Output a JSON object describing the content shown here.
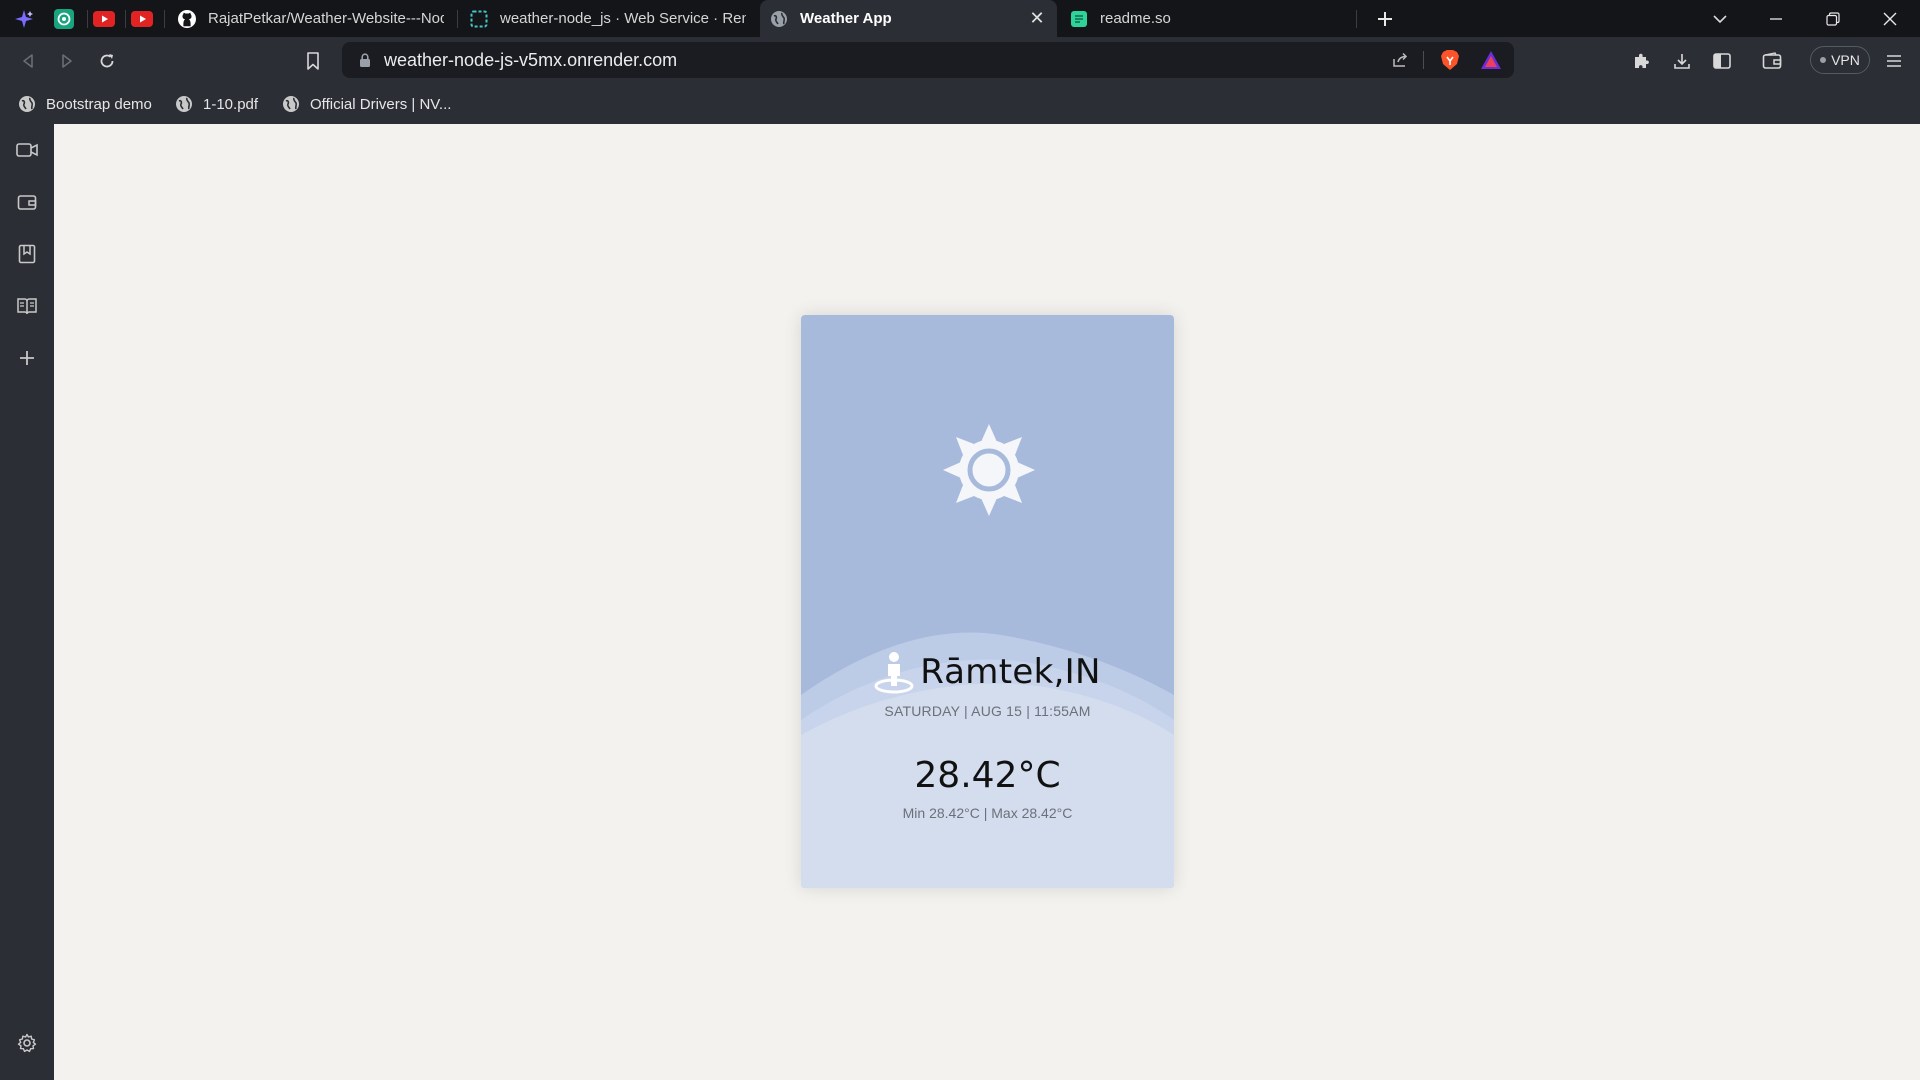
{
  "tabs": [
    {
      "title": "RajatPetkar/Weather-Website---Node-",
      "favicon": "github-icon"
    },
    {
      "title": "weather-node_js · Web Service · Rend",
      "favicon": "render-icon"
    },
    {
      "title": "Weather App",
      "favicon": "globe-icon",
      "active": true
    },
    {
      "title": "readme.so",
      "favicon": "readme-icon"
    }
  ],
  "pinned_tabs": [
    "leo-ai-icon",
    "chatgpt-icon",
    "youtube-icon",
    "youtube-icon"
  ],
  "address_bar": {
    "url": "weather-node-js-v5mx.onrender.com"
  },
  "toolbar": {
    "vpn_label": "VPN"
  },
  "bookmarks": [
    {
      "label": "Bootstrap demo"
    },
    {
      "label": "1-10.pdf"
    },
    {
      "label": "Official Drivers | NV..."
    }
  ],
  "sidebar": [
    "video-icon",
    "wallet-icon",
    "bookmarks-icon",
    "reading-list-icon",
    "add-icon",
    "settings-icon"
  ],
  "weather": {
    "icon": "sun-icon",
    "location": "Rāmtek,IN",
    "datetime": "SATURDAY | AUG 15 | 11:55AM",
    "temperature": "28.42°C",
    "minmax": "Min 28.42°C | Max 28.42°C"
  },
  "colors": {
    "card_top": "#a7badc",
    "card_bottom": "#d3ddee",
    "page_background": "#f3f2ef",
    "browser_chrome": "#2b2e35"
  }
}
